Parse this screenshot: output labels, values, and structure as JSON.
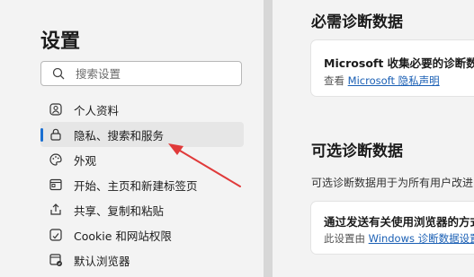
{
  "sidebar": {
    "title": "设置",
    "search_placeholder": "搜索设置",
    "items": [
      {
        "label": "个人资料",
        "icon": "profile-icon"
      },
      {
        "label": "隐私、搜索和服务",
        "icon": "lock-icon"
      },
      {
        "label": "外观",
        "icon": "appearance-icon"
      },
      {
        "label": "开始、主页和新建标签页",
        "icon": "home-icon"
      },
      {
        "label": "共享、复制和粘贴",
        "icon": "share-icon"
      },
      {
        "label": "Cookie 和网站权限",
        "icon": "cookie-icon"
      },
      {
        "label": "默认浏览器",
        "icon": "browser-icon"
      }
    ]
  },
  "main": {
    "required": {
      "heading": "必需诊断数据",
      "card_title": "Microsoft 收集必要的诊断数据",
      "card_sub_prefix": "查看",
      "card_link": "Microsoft 隐私声明"
    },
    "optional": {
      "heading": "可选诊断数据",
      "description": "可选诊断数据用于为所有用户改进",
      "card_title": "通过发送有关使用浏览器的方式",
      "card_sub_prefix": "此设置由",
      "card_link": "Windows 诊断数据设置"
    }
  },
  "annotation": {
    "color": "#e03a3a"
  }
}
